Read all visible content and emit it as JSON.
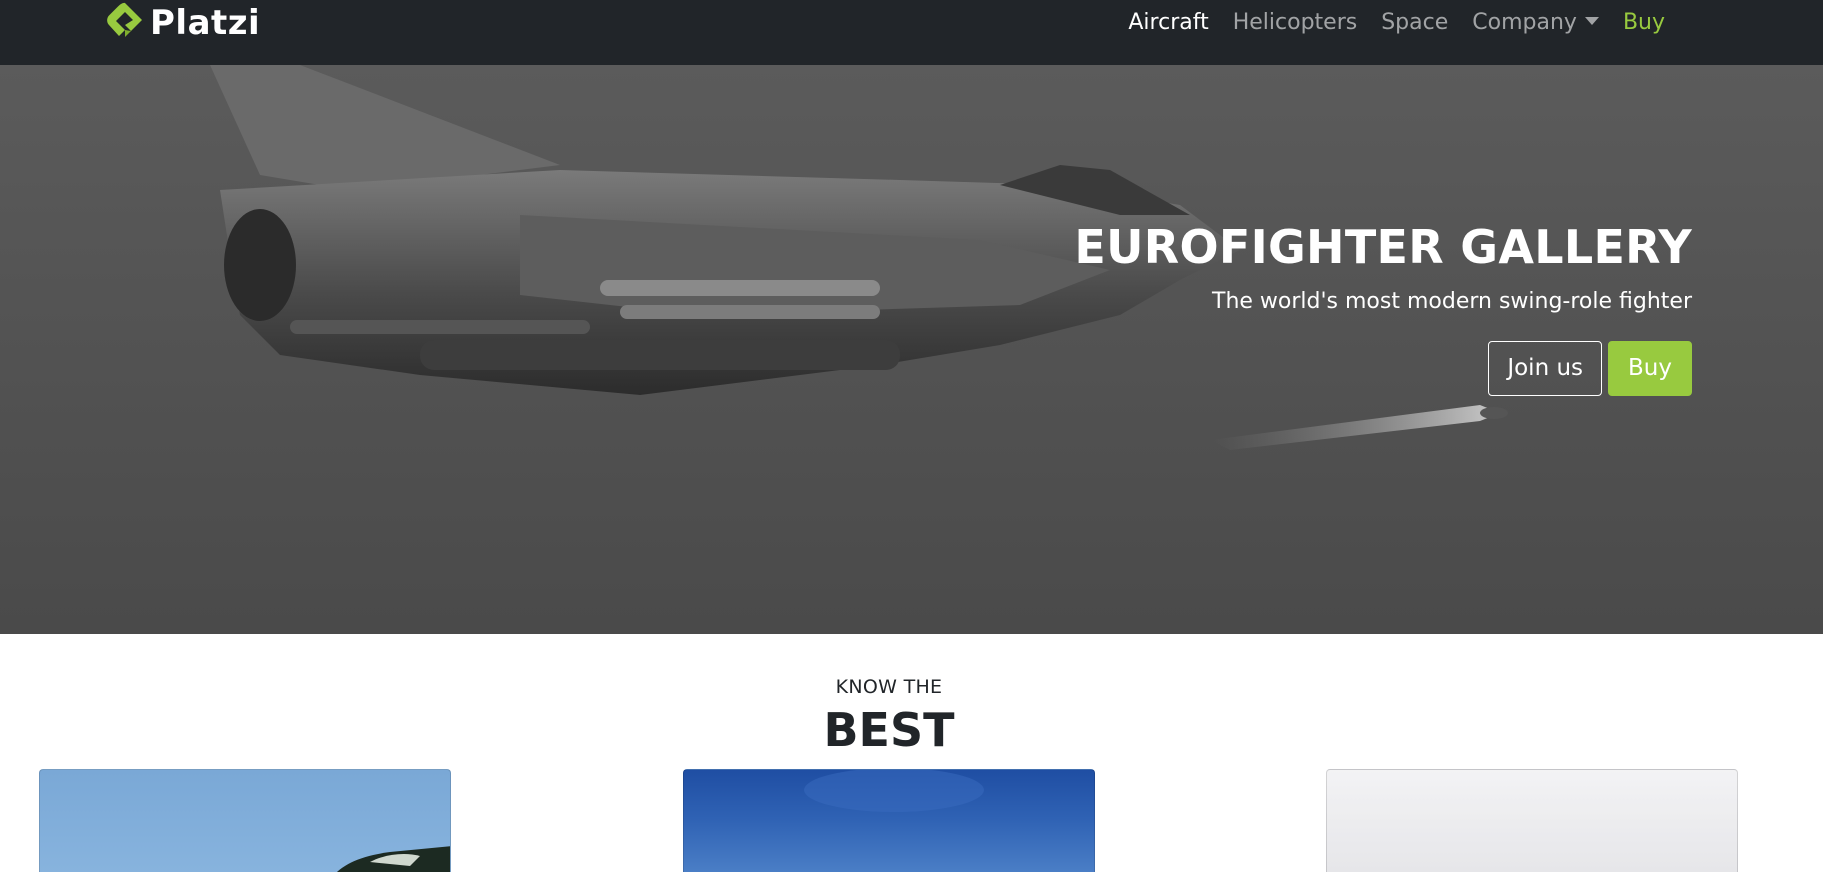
{
  "navbar": {
    "brand": "Platzi",
    "links": [
      {
        "label": "Aircraft",
        "active": true
      },
      {
        "label": "Helicopters"
      },
      {
        "label": "Space"
      },
      {
        "label": "Company",
        "dropdown": true
      },
      {
        "label": "Buy",
        "accent": true
      }
    ]
  },
  "hero": {
    "title": "EUROFIGHTER GALLERY",
    "subtitle": "The world's most modern swing-role fighter",
    "join_label": "Join us",
    "buy_label": "Buy"
  },
  "section": {
    "kicker": "KNOW THE",
    "title": "BEST"
  },
  "colors": {
    "navbar_bg": "#212529",
    "accent": "#98ca3f",
    "hero_bg": "#555555"
  },
  "icons": {
    "brand_logo": "platzi-logo-icon",
    "dropdown": "caret-down-icon"
  }
}
